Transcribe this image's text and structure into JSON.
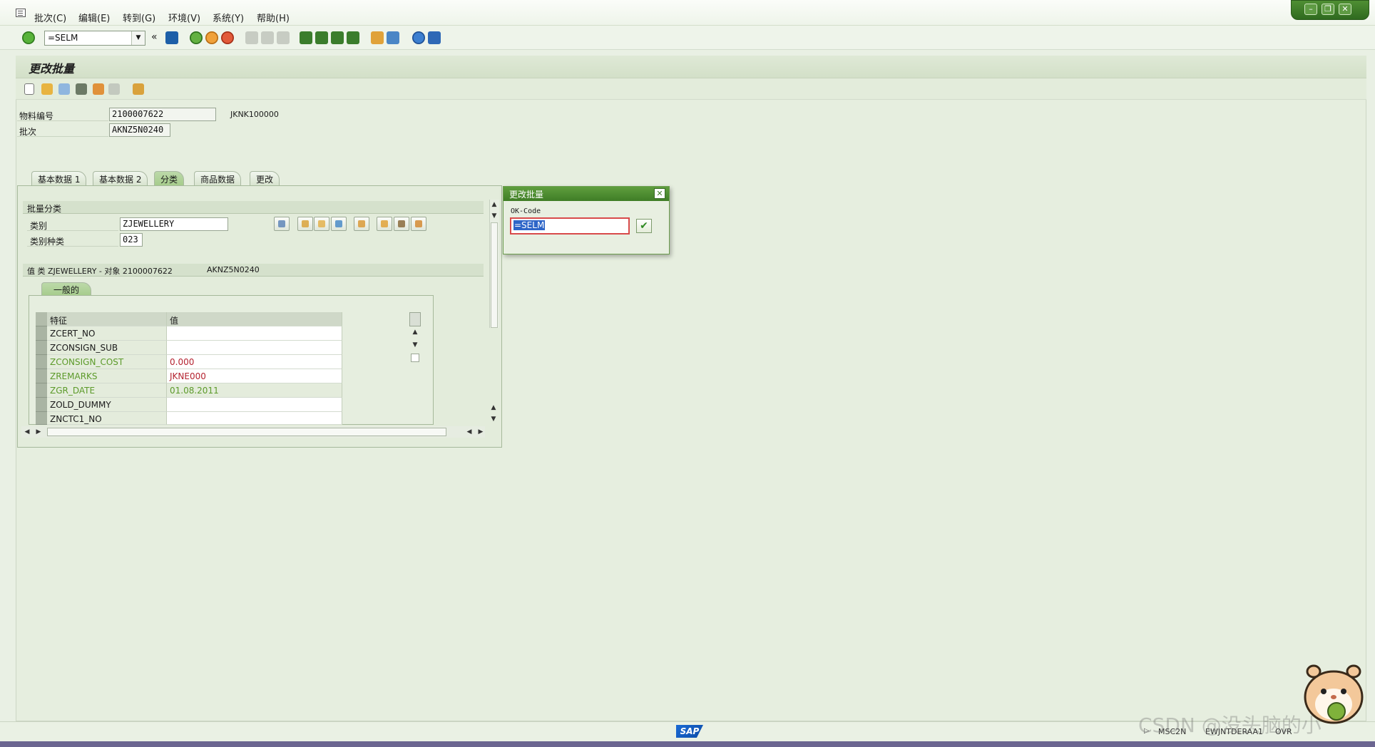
{
  "menu": {
    "items": [
      {
        "label": "批次(C)"
      },
      {
        "label": "编辑(E)"
      },
      {
        "label": "转到(G)"
      },
      {
        "label": "环境(V)"
      },
      {
        "label": "系统(Y)"
      },
      {
        "label": "帮助(H)"
      }
    ]
  },
  "toolbar": {
    "command_value": "=SELM"
  },
  "page": {
    "title": "更改批量"
  },
  "header": {
    "material_label": "物料编号",
    "material_value": "2100007622",
    "material_desc": "JKNK100000",
    "batch_label": "批次",
    "batch_value": "AKNZ5N0240"
  },
  "tabs": [
    {
      "label": "基本数据 1",
      "active": false
    },
    {
      "label": "基本数据 2",
      "active": false
    },
    {
      "label": "分类",
      "active": true
    },
    {
      "label": "商品数据",
      "active": false
    },
    {
      "label": "更改",
      "active": false
    }
  ],
  "classification": {
    "section_title": "批量分类",
    "class_label": "类别",
    "class_value": "ZJEWELLERY",
    "class_type_label": "类别种类",
    "class_type_value": "023",
    "values_header": "值 类 ZJEWELLERY - 对象 2100007622",
    "values_header_batch": "AKNZ5N0240",
    "subtab_label": "一般的"
  },
  "table": {
    "columns": [
      "特征",
      "值"
    ],
    "rows": [
      {
        "feature": "ZCERT_NO",
        "value": "",
        "style": "normal"
      },
      {
        "feature": "ZCONSIGN_SUB",
        "value": "",
        "style": "normal"
      },
      {
        "feature": "ZCONSIGN_COST",
        "value": "0.000",
        "style": "green"
      },
      {
        "feature": "ZREMARKS",
        "value": "JKNE000",
        "style": "green"
      },
      {
        "feature": "ZGR_DATE",
        "value": "01.08.2011",
        "style": "greenval"
      },
      {
        "feature": "ZOLD_DUMMY",
        "value": "",
        "style": "normal"
      },
      {
        "feature": "ZNCTC1_NO",
        "value": "",
        "style": "normal"
      }
    ]
  },
  "dialog": {
    "title": "更改批量",
    "okcode_label": "OK-Code",
    "okcode_value": "=SELM"
  },
  "status": {
    "tcode": "MSC2N",
    "server": "EWJNTDERAA1",
    "mode": "OVR",
    "logo": "SAP"
  },
  "watermark": "CSDN @没头脑的小",
  "colors": {
    "sap_green": "#3f7d26",
    "background": "#e9f0e4",
    "value_red": "#b4222f",
    "feature_green": "#5c9a2a",
    "selection_blue": "#2e66c8"
  }
}
